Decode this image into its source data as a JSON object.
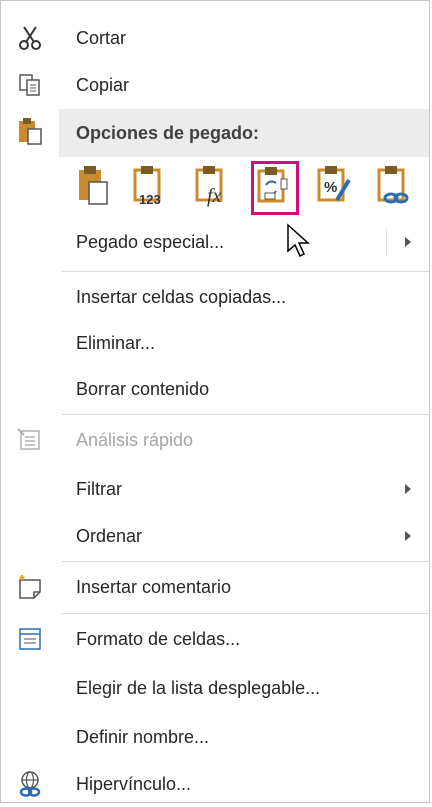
{
  "menu": {
    "cut": {
      "label": "Cortar",
      "icon": "scissors-icon"
    },
    "copy": {
      "label": "Copiar",
      "icon": "copy-icon"
    },
    "paste_options": {
      "header": "Opciones de pegado:",
      "icon": "clipboard-icon",
      "options": [
        {
          "name": "paste-icon"
        },
        {
          "name": "paste-values-icon",
          "text": "123"
        },
        {
          "name": "paste-formulas-icon",
          "text": "fx"
        },
        {
          "name": "paste-transpose-icon",
          "selected": true
        },
        {
          "name": "paste-formatting-icon",
          "text": "%"
        },
        {
          "name": "paste-link-icon"
        }
      ]
    },
    "paste_special": {
      "label": "Pegado especial..."
    },
    "insert_copied_cells": {
      "label": "Insertar celdas copiadas..."
    },
    "delete": {
      "label": "Eliminar..."
    },
    "clear_contents": {
      "label": "Borrar contenido"
    },
    "quick_analysis": {
      "label": "Análisis rápido",
      "disabled": true
    },
    "filter": {
      "label": "Filtrar"
    },
    "sort": {
      "label": "Ordenar"
    },
    "insert_comment": {
      "label": "Insertar comentario"
    },
    "format_cells": {
      "label": "Formato de celdas..."
    },
    "pick_from_list": {
      "label": "Elegir de la lista desplegable..."
    },
    "define_name": {
      "label": "Definir nombre..."
    },
    "hyperlink": {
      "label": "Hipervínculo..."
    }
  },
  "colors": {
    "selected_outline": "#d0107f",
    "clipboard_brown": "#c98b2c"
  }
}
